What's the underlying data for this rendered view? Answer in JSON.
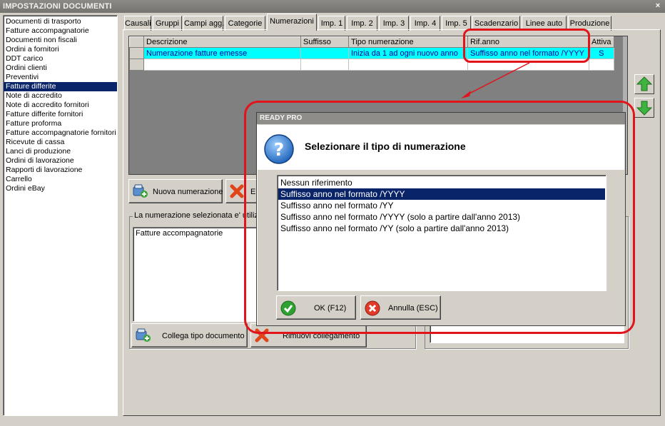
{
  "window": {
    "title": "IMPOSTAZIONI DOCUMENTI",
    "close": "×"
  },
  "doc_types": [
    "Documenti di trasporto",
    "Fatture accompagnatorie",
    "Documenti non fiscali",
    "Ordini a fornitori",
    "DDT carico",
    "Ordini clienti",
    "Preventivi",
    "Fatture differite",
    "Note di accredito",
    "Note di accredito fornitori",
    "Fatture differite fornitori",
    "Fatture proforma",
    "Fatture accompagnatorie fornitori",
    "Ricevute di cassa",
    "Lanci di produzione",
    "Ordini di lavorazione",
    "Rapporti di lavorazione",
    "Carrello",
    "Ordini eBay"
  ],
  "selected_doc_type": "Fatture differite",
  "tabs": [
    "Causali",
    "Gruppi",
    "Campi agg.",
    "Categorie",
    "Numerazioni",
    "Imp. 1",
    "Imp. 2",
    "Imp. 3",
    "Imp. 4",
    "Imp. 5",
    "Scadenzario",
    "Linee auto",
    "Produzione"
  ],
  "active_tab": "Numerazioni",
  "grid": {
    "columns": [
      "Descrizione",
      "Suffisso",
      "Tipo numerazione",
      "Rif.anno",
      "Attiva"
    ],
    "rows": [
      {
        "descrizione": "Numerazione fatture emesse",
        "suffisso": "",
        "tipo": "Inizia da 1 ad ogni nuovo anno",
        "rif_anno": "Suffisso anno nel formato /YYYY",
        "attiva": "S"
      }
    ]
  },
  "buttons": {
    "new_numbering": "Nuova numerazione",
    "delete_partial": "E",
    "link_doc_type": "Collega tipo documento",
    "remove_link": "Rimuovi collegamento"
  },
  "usage_group": {
    "title": "La numerazione selezionata e' utilizz",
    "items": [
      "Fatture accompagnatorie"
    ]
  },
  "dialog": {
    "title": "READY PRO",
    "message": "Selezionare il tipo di numerazione",
    "options": [
      "Nessun riferimento",
      "Suffisso anno nel formato /YYYY",
      "Suffisso anno nel formato /YY",
      "Suffisso anno nel formato /YYYY (solo a partire dall'anno 2013)",
      "Suffisso anno nel formato /YY (solo a partire dall'anno 2013)"
    ],
    "selected_option": "Suffisso anno nel formato /YYYY",
    "ok_label": "OK (F12)",
    "cancel_label": "Annulla (ESC)"
  },
  "colors": {
    "highlight_red": "#e0141a",
    "selection_navy": "#0a246a",
    "row_cyan": "#00ffff"
  }
}
